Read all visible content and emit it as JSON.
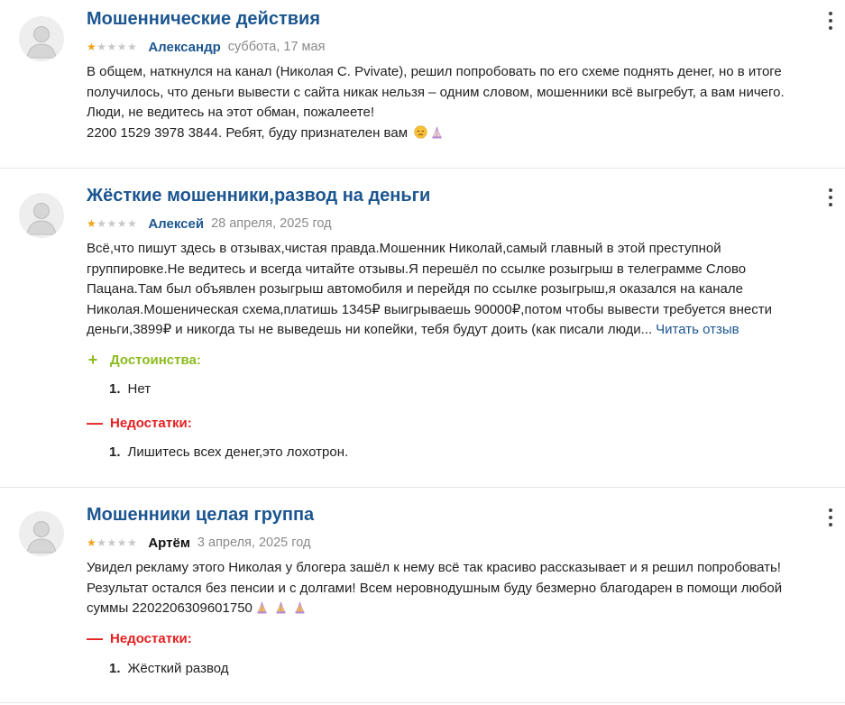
{
  "reviews": [
    {
      "title": "Мошеннические действия",
      "author": "Александр",
      "date": "суббота, 17 мая",
      "rating": 1,
      "lines": [
        "В общем, наткнулся на канал (Николая С. Pvivate), решил попробовать по его схеме поднять денег, но в итоге",
        "получилось, что деньги вывести с сайта никак нельзя – одним словом, мошенники всё выгребут, а вам ничего.",
        "Люди, не ведитесь на этот обман, пожалеете!",
        "2200 1529 3978 3844. Ребят, буду признателен вам"
      ]
    },
    {
      "title": "Жёсткие мошенники,развод на деньги",
      "author": "Алексей",
      "date": "28 апреля, 2025 год",
      "rating": 1,
      "lines": [
        "Всё,что пишут здесь в отзывах,чистая правда.Мошенник Николай,самый главный в этой преступной",
        "группировке.Не ведитесь и всегда читайте отзывы.Я перешёл по ссылке розыгрыш в телеграмме Слово",
        "Пацана.Там был объявлен розыгрыш автомобиля и перейдя по ссылке розыгрыш,я оказался на канале",
        "Николая.Мошеническая схема,платишь 1345₽ выигрываешь 90000₽,потом чтобы вывести требуется внести",
        "деньги,3899₽ и никогда ты не выведешь ни копейки, тебя будут доить (как писали люди..."
      ],
      "read_more": "Читать отзыв",
      "pros_label": "Достоинства:",
      "pros": [
        "Нет"
      ],
      "cons_label": "Недостатки:",
      "cons": [
        "Лишитесь всех денег,это лохотрон."
      ]
    },
    {
      "title": "Мошенники целая группа",
      "author": "Артём",
      "date": "3 апреля, 2025 год",
      "rating": 1,
      "lines": [
        "Увидел рекламу этого Николая у блогера зашёл к нему всё так красиво рассказывает и я решил попробовать!",
        "Результат остался без пенсии и с долгами! Всем неровнодушным буду безмерно благодарен в помощи любой",
        "суммы 2202206309601750"
      ],
      "cons_label": "Недостатки:",
      "cons": [
        "Жёсткий развод"
      ]
    }
  ],
  "list_number": "1.",
  "pros_sign": "+",
  "cons_sign": "—",
  "icons": {
    "avatar": "user-avatar-icon",
    "more": "kebab-menu-icon",
    "disappointed": "disappointed-face-emoji",
    "pray": "folded-hands-emoji"
  },
  "colors": {
    "link": "#1c5690",
    "star_on": "#f0a317",
    "star_off": "#c8c8c8",
    "pros": "#8bbb1e",
    "cons": "#e52020"
  }
}
